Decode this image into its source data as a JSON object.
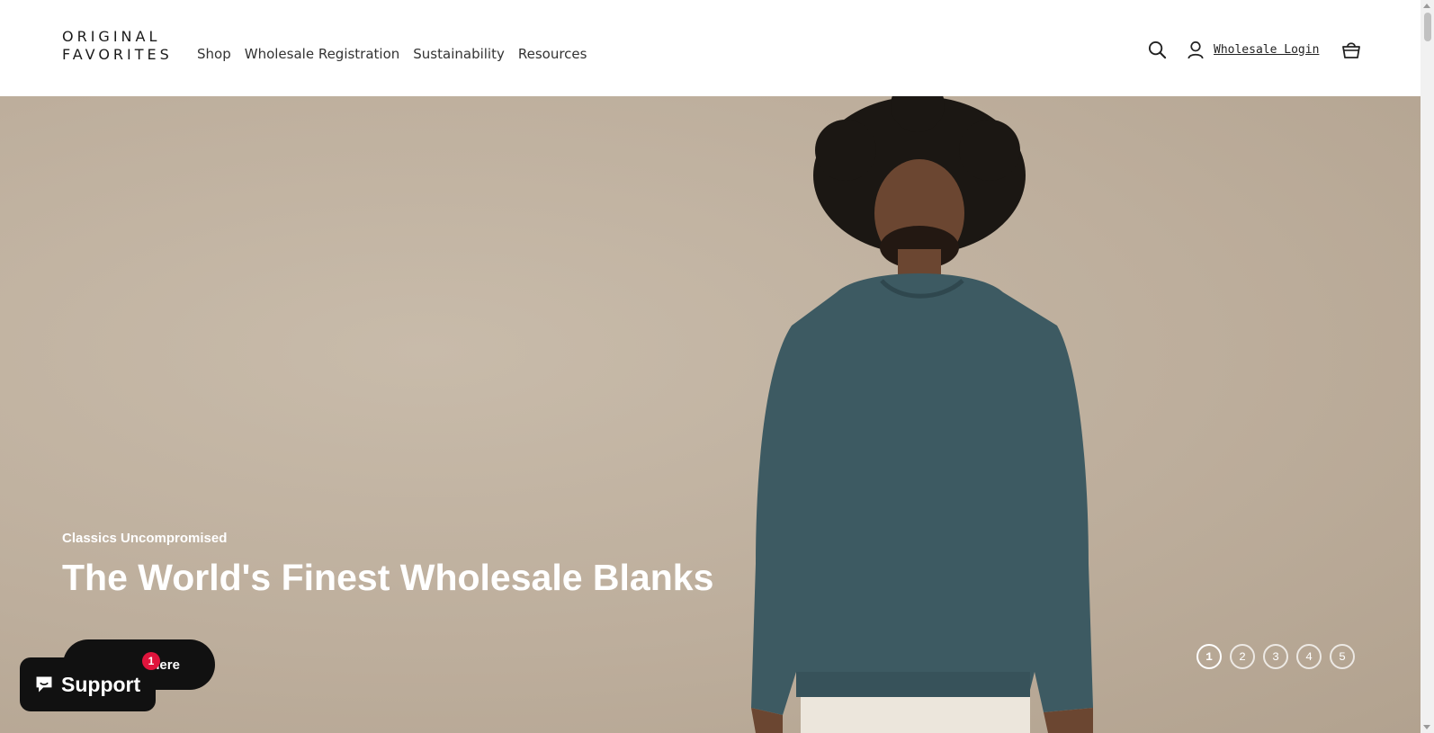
{
  "header": {
    "logo": {
      "line1": "ORIGINAL",
      "line2": "FAVORITES"
    },
    "nav": [
      {
        "label": "Shop"
      },
      {
        "label": "Wholesale Registration"
      },
      {
        "label": "Sustainability"
      },
      {
        "label": "Resources"
      }
    ],
    "icons": {
      "search": "search-icon",
      "account": "user-icon",
      "cart": "basket-icon"
    },
    "login_label": "Wholesale Login"
  },
  "hero": {
    "subtitle": "Classics Uncompromised",
    "title": "The World's Finest Wholesale Blanks",
    "cta_label": "Explore here",
    "slides": [
      "1",
      "2",
      "3",
      "4",
      "5"
    ],
    "active_slide": 1,
    "colors": {
      "background": "#c1b3a2",
      "sweater": "#3d5a62"
    }
  },
  "support_widget": {
    "label": "Support",
    "badge_count": "1",
    "icon": "chat-bubble-icon"
  }
}
